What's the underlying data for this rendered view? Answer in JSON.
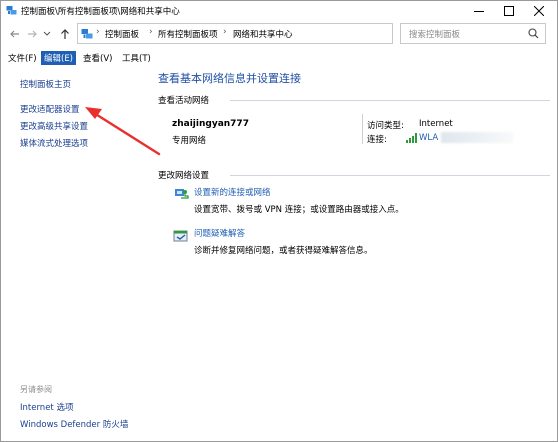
{
  "window": {
    "title": "控制面板\\所有控制面板项\\网络和共享中心",
    "minimize": "minimize",
    "maximize": "maximize",
    "close": "close"
  },
  "address": {
    "breadcrumbs": [
      "控制面板",
      "所有控制面板项",
      "网络和共享中心"
    ],
    "search_placeholder": "搜索控制面板"
  },
  "menu": {
    "items": [
      {
        "label": "文件(F)",
        "active": false
      },
      {
        "label": "编辑(E)",
        "active": true
      },
      {
        "label": "查看(V)",
        "active": false
      },
      {
        "label": "工具(T)",
        "active": false
      }
    ]
  },
  "sidebar": {
    "links": [
      "控制面板主页",
      "更改适配器设置",
      "更改高级共享设置",
      "媒体流式处理选项"
    ],
    "see_also_title": "另请参阅",
    "see_also": [
      "Internet 选项",
      "Windows Defender 防火墙"
    ]
  },
  "main": {
    "title": "查看基本网络信息并设置连接",
    "active_networks_title": "查看活动网络",
    "network": {
      "name": "zhaijingyan777",
      "type": "专用网络",
      "access_label": "访问类型:",
      "access_value": "Internet",
      "connection_label": "连接:",
      "connection_value": "WLA"
    },
    "change_settings_title": "更改网络设置",
    "tasks": [
      {
        "link": "设置新的连接或网络",
        "desc": "设置宽带、拨号或 VPN 连接；或设置路由器或接入点。",
        "icon": "network-setup-icon"
      },
      {
        "link": "问题疑难解答",
        "desc": "诊断并修复网络问题，或者获得疑难解答信息。",
        "icon": "troubleshoot-icon"
      }
    ]
  },
  "colors": {
    "accent": "#1e5fb4",
    "link": "#1a3f8f",
    "annotation_arrow": "#e8312f"
  }
}
